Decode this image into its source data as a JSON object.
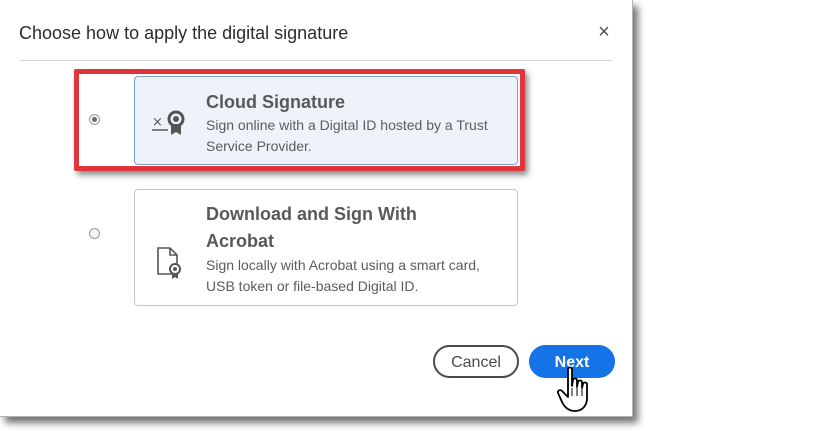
{
  "dialog": {
    "title": "Choose how to apply the digital signature",
    "close_label": "×"
  },
  "options": [
    {
      "title": "Cloud Signature",
      "description": "Sign online with a Digital ID hosted by a Trust Service Provider.",
      "icon": "cloud-signature-icon",
      "selected": true
    },
    {
      "title": "Download and Sign With Acrobat",
      "description": "Sign locally with Acrobat using a smart card, USB token or file-based Digital ID.",
      "icon": "document-certificate-icon",
      "selected": false
    }
  ],
  "buttons": {
    "cancel": "Cancel",
    "next": "Next"
  },
  "colors": {
    "primary": "#1473e6",
    "highlight": "#e0363b",
    "selected_card_bg": "#eef3f9"
  }
}
